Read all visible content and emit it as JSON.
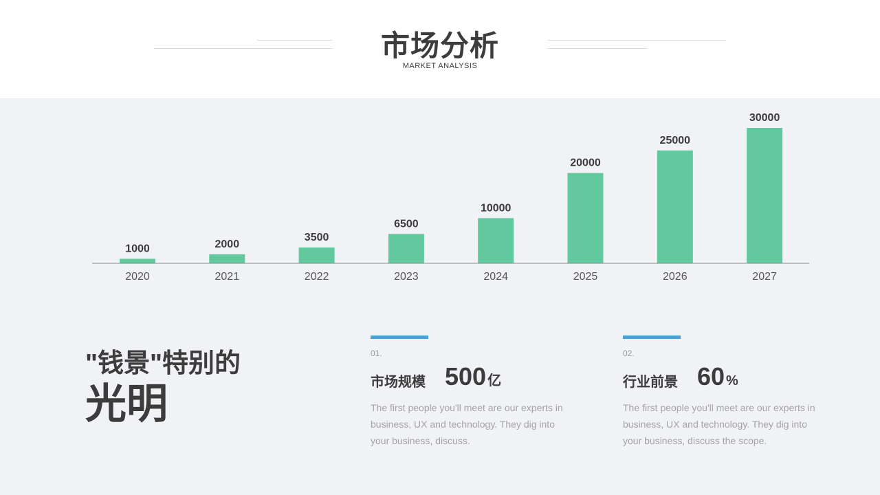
{
  "header": {
    "title": "市场分析",
    "subtitle": "MARKET ANALYSIS"
  },
  "chart_data": {
    "type": "bar",
    "categories": [
      "2020",
      "2021",
      "2022",
      "2023",
      "2024",
      "2025",
      "2026",
      "2027"
    ],
    "values": [
      1000,
      2000,
      3500,
      6500,
      10000,
      20000,
      25000,
      30000
    ],
    "data_labels": [
      "1000",
      "2000",
      "3500",
      "6500",
      "10000",
      "20000",
      "25000",
      "30000"
    ],
    "title": "",
    "xlabel": "",
    "ylabel": "",
    "ylim": [
      0,
      30000
    ],
    "bar_color": "#62c99e",
    "grid": false,
    "legend": "none"
  },
  "headline": {
    "line1": "\"钱景\"特别的",
    "line2": "光明"
  },
  "stats": [
    {
      "index": "01.",
      "label": "市场规模",
      "value": "500",
      "unit": "亿",
      "description": "The first people you'll meet are our experts in business, UX  and technology. They dig into your business, discuss."
    },
    {
      "index": "02.",
      "label": "行业前景",
      "value": "60",
      "unit": "%",
      "description": "The first people you'll meet are our experts in business, UX  and technology. They dig into your business, discuss the scope."
    }
  ],
  "colors": {
    "accent_blue": "#4a9fd4",
    "bar_green": "#62c99e",
    "background": "#f1f2f6"
  }
}
